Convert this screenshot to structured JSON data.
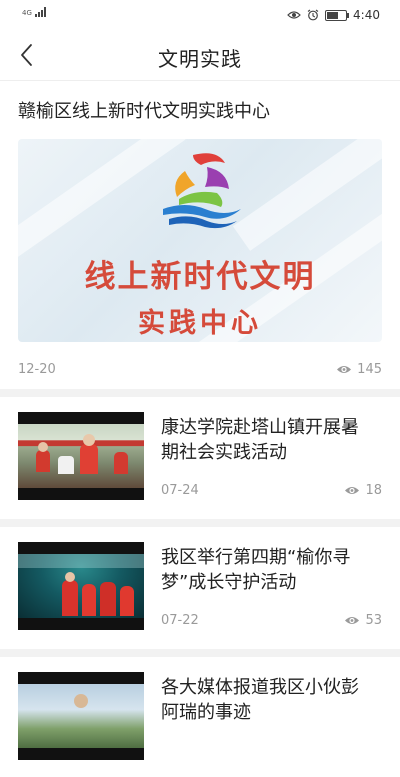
{
  "status_bar": {
    "signal_label": "4G",
    "time": "4:40"
  },
  "nav": {
    "title": "文明实践"
  },
  "featured": {
    "title": "赣榆区线上新时代文明实践中心",
    "banner_line1": "线上新时代文明",
    "banner_line2": "实践中心",
    "date": "12-20",
    "views": "145"
  },
  "articles": [
    {
      "title": "康达学院赴塔山镇开展暑期社会实践活动",
      "date": "07-24",
      "views": "18"
    },
    {
      "title": "我区举行第四期“榆你寻梦”成长守护活动",
      "date": "07-22",
      "views": "53"
    },
    {
      "title": "各大媒体报道我区小伙彭阿瑞的事迹",
      "date": "",
      "views": ""
    }
  ],
  "colors": {
    "banner_text": "#d54a3a",
    "meta_text": "#9a9a9a",
    "divider": "#f2f2f2"
  },
  "icons": {
    "back": "chevron-left-icon",
    "views": "eye-icon"
  }
}
